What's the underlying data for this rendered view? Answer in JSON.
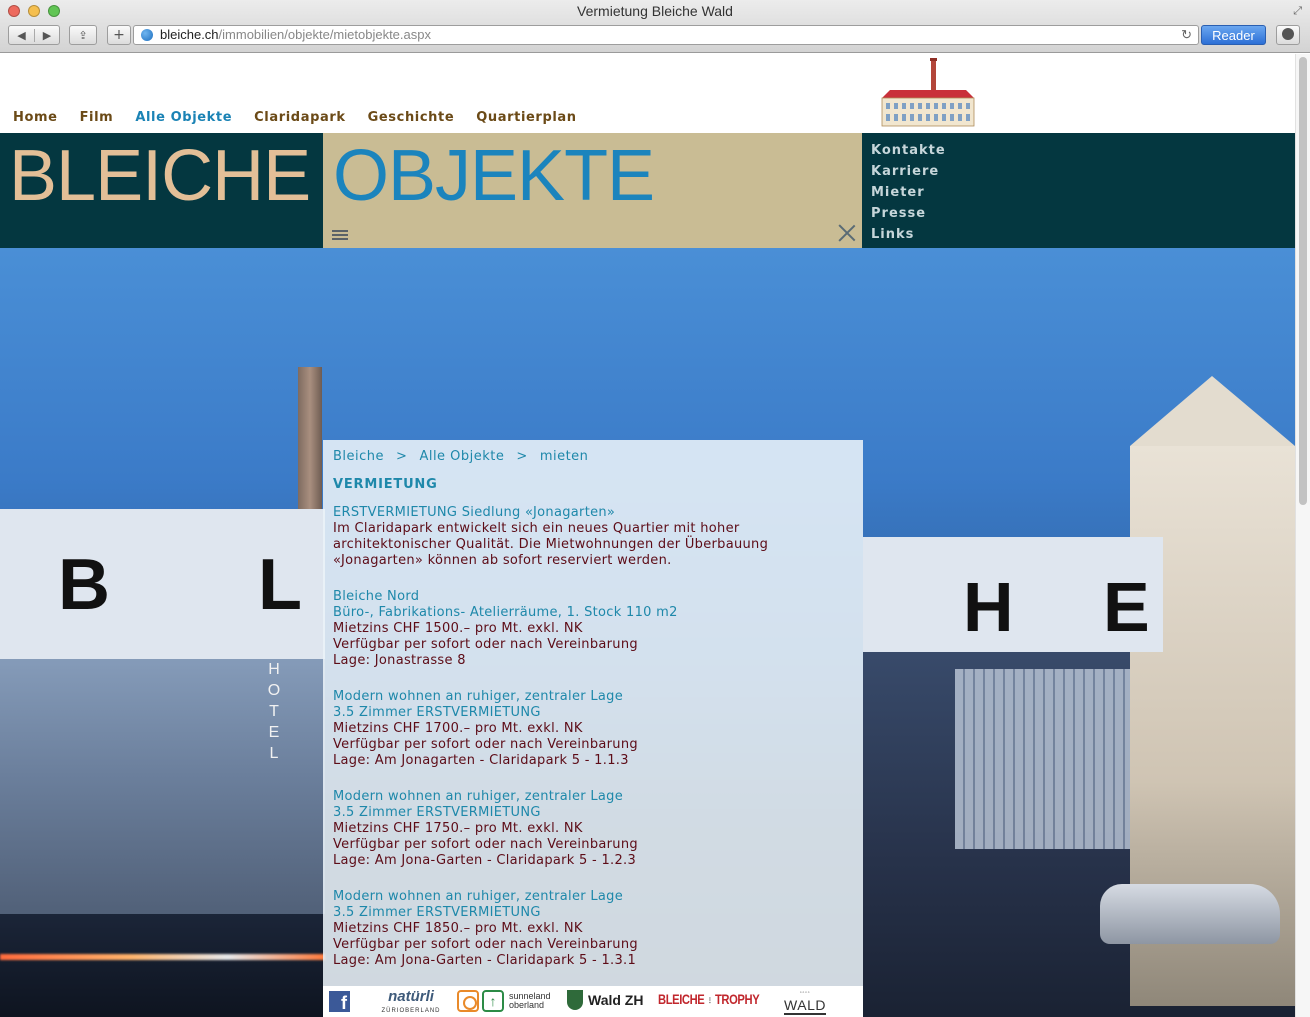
{
  "window": {
    "title": "Vermietung Bleiche Wald"
  },
  "browser": {
    "url_host": "bleiche.ch",
    "url_path": "/immobilien/objekte/mietobjekte.aspx",
    "reader_label": "Reader"
  },
  "topnav": [
    {
      "label": "Home",
      "active": false
    },
    {
      "label": "Film",
      "active": false
    },
    {
      "label": "Alle Objekte",
      "active": true
    },
    {
      "label": "Claridapark",
      "active": false
    },
    {
      "label": "Geschichte",
      "active": false
    },
    {
      "label": "Quartierplan",
      "active": false
    }
  ],
  "header": {
    "title_left": "BLEICHE",
    "title_mid": "OBJEKTE"
  },
  "sidenav": [
    "Kontakte",
    "Karriere",
    "Mieter",
    "Presse",
    "Links"
  ],
  "hero": {
    "bridge_left_letters": [
      "B",
      "L"
    ],
    "bridge_right_letters": [
      "H",
      "E"
    ],
    "hotel_sign": "HOTEL"
  },
  "breadcrumb": [
    "Bleiche",
    "Alle Objekte",
    "mieten"
  ],
  "breadcrumb_sep": ">",
  "section_title": "VERMIETUNG",
  "entries": [
    {
      "titles": [
        "ERSTVERMIETUNG Siedlung «Jonagarten»"
      ],
      "lines": [
        "Im Claridapark entwickelt sich ein neues Quartier mit hoher architektonischer Qualität. Die Mietwohnungen der Überbauung «Jonagarten» können ab sofort reserviert werden."
      ]
    },
    {
      "titles": [
        "Bleiche Nord",
        "Büro-, Fabrikations- Atelierräume, 1. Stock 110 m2"
      ],
      "lines": [
        "Mietzins CHF 1500.– pro Mt. exkl. NK",
        "Verfügbar per sofort oder nach Vereinbarung",
        "Lage: Jonastrasse 8"
      ]
    },
    {
      "titles": [
        "Modern wohnen an ruhiger, zentraler Lage",
        "3.5 Zimmer ERSTVERMIETUNG"
      ],
      "lines": [
        "Mietzins CHF 1700.– pro Mt. exkl. NK",
        "Verfügbar per sofort oder nach Vereinbarung",
        "Lage: Am Jonagarten - Claridapark 5 - 1.1.3"
      ]
    },
    {
      "titles": [
        "Modern wohnen an ruhiger, zentraler Lage",
        "3.5 Zimmer ERSTVERMIETUNG"
      ],
      "lines": [
        "Mietzins CHF 1750.– pro Mt. exkl. NK",
        "Verfügbar per sofort oder nach Vereinbarung",
        "Lage: Am Jona-Garten - Claridapark 5 - 1.2.3"
      ]
    },
    {
      "titles": [
        "Modern wohnen an ruhiger, zentraler Lage",
        "3.5 Zimmer ERSTVERMIETUNG"
      ],
      "lines": [
        "Mietzins CHF 1850.– pro Mt. exkl. NK",
        "Verfügbar per sofort oder nach Vereinbarung",
        "Lage: Am Jona-Garten - Claridapark 5 - 1.3.1"
      ]
    }
  ],
  "footer_logos": {
    "facebook": "f",
    "natuerli": "natürli",
    "natuerli_sub": "ZÜRIOBERLAND",
    "sunneland_1": "sunneland",
    "sunneland_2": "oberland",
    "wald": "Wald ZH",
    "trophy_1": "BLEICHE",
    "trophy_2": "TROPHY",
    "rollt": "WALD ROLLT"
  },
  "colors": {
    "dark_teal": "#043740",
    "sand": "#c9bc94",
    "link_blue": "#1e88aa",
    "body_text": "#5d0c17",
    "nav_brown": "#6b4a17"
  }
}
